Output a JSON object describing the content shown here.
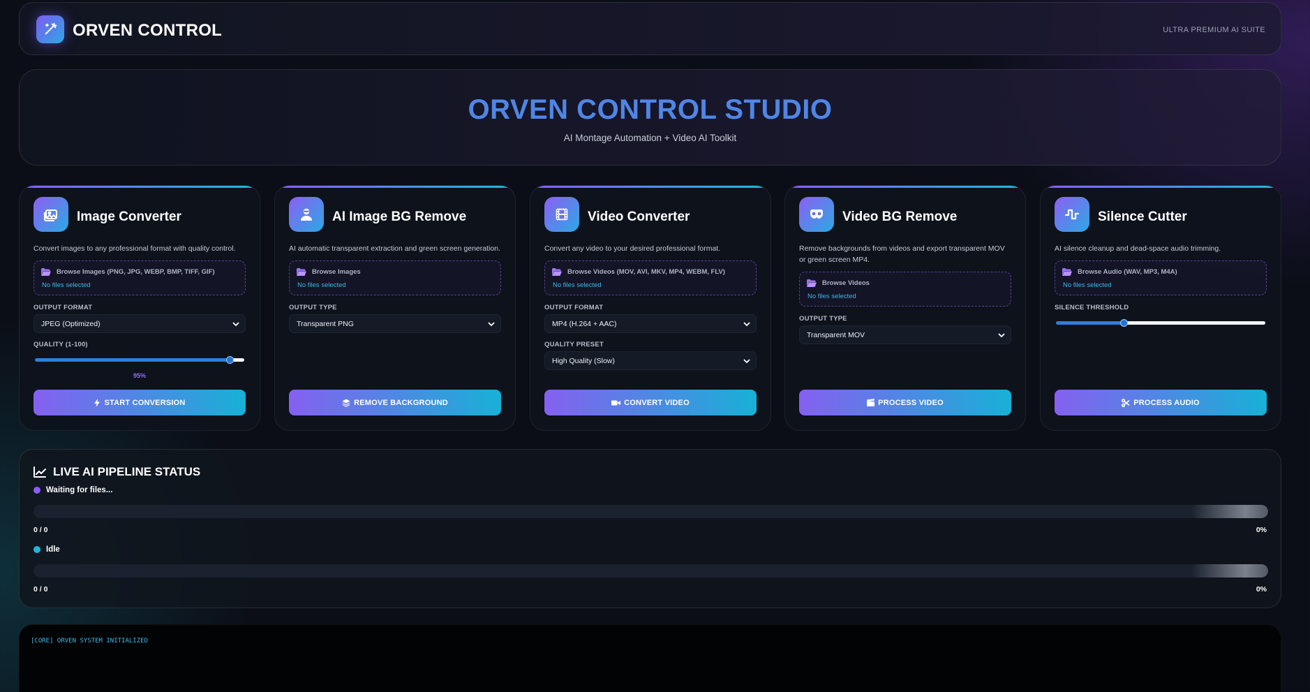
{
  "header": {
    "brand": "ORVEN CONTROL",
    "suite": "ULTRA PREMIUM AI SUITE"
  },
  "hero": {
    "title": "ORVEN CONTROL STUDIO",
    "subtitle": "AI Montage Automation + Video AI Toolkit"
  },
  "cards": [
    {
      "title": "Image Converter",
      "description": "Convert images to any professional format with quality control.",
      "browse_label": "Browse Images (PNG, JPG, WEBP, BMP, TIFF, GIF)",
      "no_files": "No files selected",
      "field1_label": "OUTPUT FORMAT",
      "field1_value": "JPEG (Optimized)",
      "field2_label": "QUALITY (1-100)",
      "quality_value": 95,
      "quality_text": "95%",
      "action_label": "START CONVERSION"
    },
    {
      "title": "AI Image BG Remove",
      "description": "AI automatic transparent extraction and green screen generation.",
      "browse_label": "Browse Images",
      "no_files": "No files selected",
      "field1_label": "OUTPUT TYPE",
      "field1_value": "Transparent PNG",
      "action_label": "REMOVE BACKGROUND"
    },
    {
      "title": "Video Converter",
      "description": "Convert any video to your desired professional format.",
      "browse_label": "Browse Videos (MOV, AVI, MKV, MP4, WEBM, FLV)",
      "no_files": "No files selected",
      "field1_label": "OUTPUT FORMAT",
      "field1_value": "MP4 (H.264 + AAC)",
      "field2_label": "QUALITY PRESET",
      "field2_value": "High Quality (Slow)",
      "action_label": "CONVERT VIDEO"
    },
    {
      "title": "Video BG Remove",
      "description": "Remove backgrounds from videos and export transparent MOV or green screen MP4.",
      "browse_label": "Browse Videos",
      "no_files": "No files selected",
      "field1_label": "OUTPUT TYPE",
      "field1_value": "Transparent MOV",
      "action_label": "PROCESS VIDEO"
    },
    {
      "title": "Silence Cutter",
      "description": "AI silence cleanup and dead-space audio trimming.",
      "browse_label": "Browse Audio (WAV, MP3, M4A)",
      "no_files": "No files selected",
      "field1_label": "SILENCE THRESHOLD",
      "threshold_fraction": 0.32,
      "action_label": "PROCESS AUDIO"
    }
  ],
  "pipeline": {
    "title": "LIVE AI PIPELINE STATUS",
    "tracks": [
      {
        "status": "Waiting for files...",
        "count": "0 / 0",
        "percent": "0%",
        "progress": 0,
        "color": "#8b5cf6"
      },
      {
        "status": "Idle",
        "count": "0 / 0",
        "percent": "0%",
        "progress": 0,
        "color": "#1fb7d6"
      }
    ]
  },
  "console": {
    "line": "[CORE] ORVEN SYSTEM INITIALIZED"
  },
  "colors": {
    "accent_start": "#8b5cf6",
    "accent_end": "#1fb7d6",
    "title_blue": "#4f86e6",
    "link": "#3fb7e6"
  }
}
